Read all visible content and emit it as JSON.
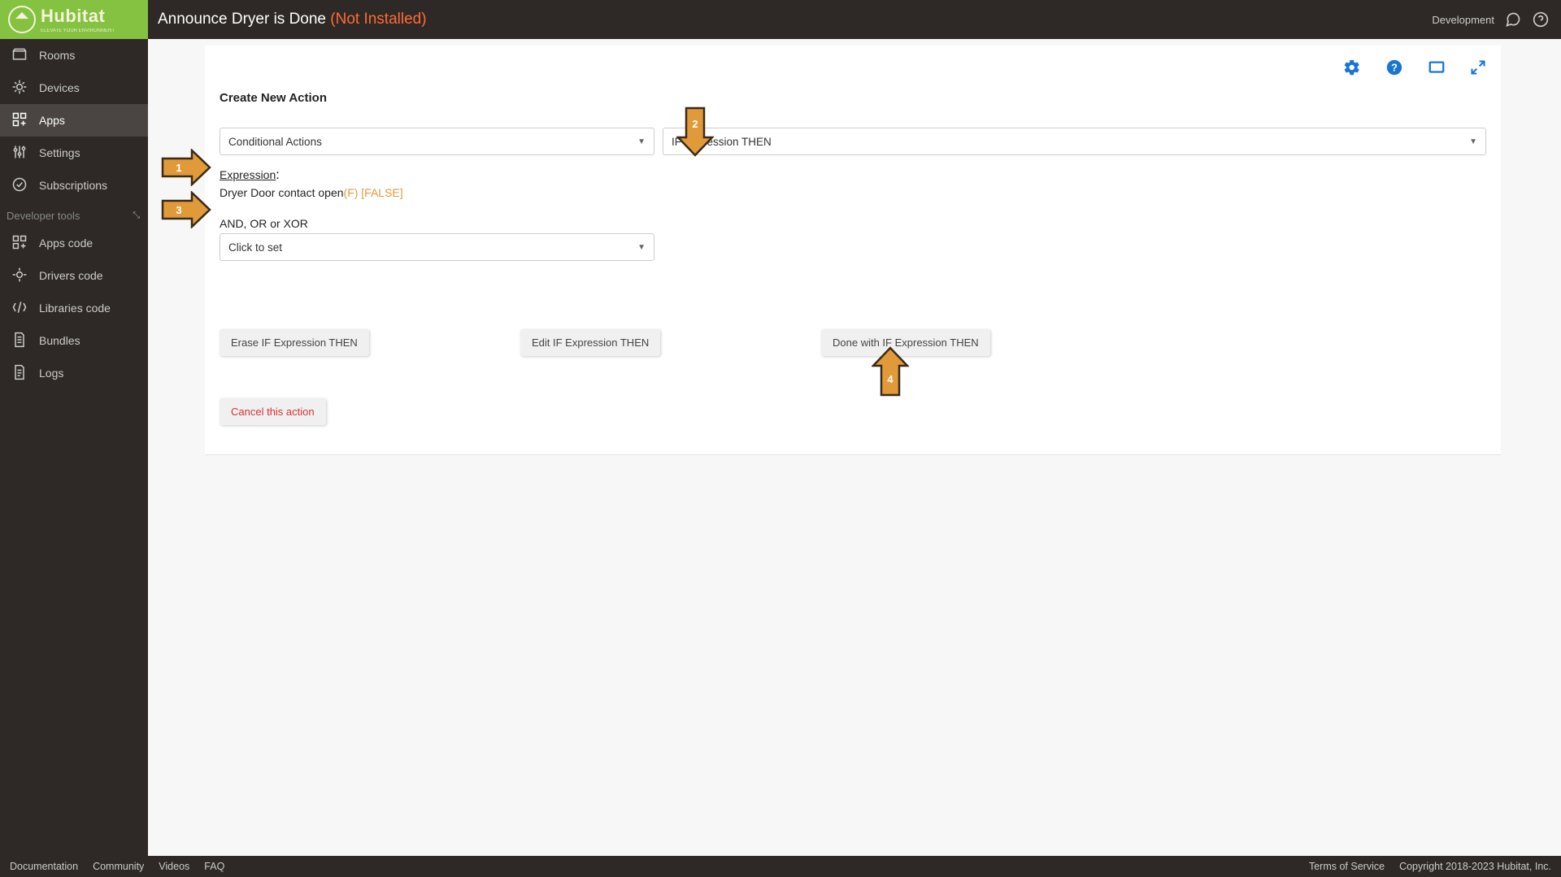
{
  "header": {
    "brand": "Hubitat",
    "brand_sub": "ELEVATE YOUR ENVIRONMENT",
    "title_prefix": "Announce Dryer is Done",
    "title_status": "(Not Installed)",
    "env_label": "Development"
  },
  "sidebar": {
    "items": [
      {
        "label": "Rooms"
      },
      {
        "label": "Devices"
      },
      {
        "label": "Apps"
      },
      {
        "label": "Settings"
      },
      {
        "label": "Subscriptions"
      }
    ],
    "section_label": "Developer tools",
    "dev_items": [
      {
        "label": "Apps code"
      },
      {
        "label": "Drivers code"
      },
      {
        "label": "Libraries code"
      },
      {
        "label": "Bundles"
      },
      {
        "label": "Logs"
      }
    ]
  },
  "main": {
    "section_title": "Create New Action",
    "select1": "Conditional Actions",
    "select2": "IF Expression THEN",
    "expr_label": "Expression",
    "expr_text": "Dryer Door contact open",
    "expr_suffix": "(F) [FALSE]",
    "andor_label": "AND, OR or XOR",
    "andor_value": "Click to set",
    "btn_erase": "Erase IF Expression THEN",
    "btn_edit": "Edit IF Expression THEN",
    "btn_done": "Done with IF Expression THEN",
    "btn_cancel": "Cancel this action"
  },
  "footer": {
    "links": [
      "Documentation",
      "Community",
      "Videos",
      "FAQ"
    ],
    "tos": "Terms of Service",
    "copyright": "Copyright 2018-2023 Hubitat, Inc."
  },
  "arrows": {
    "n1": "1",
    "n2": "2",
    "n3": "3",
    "n4": "4"
  }
}
